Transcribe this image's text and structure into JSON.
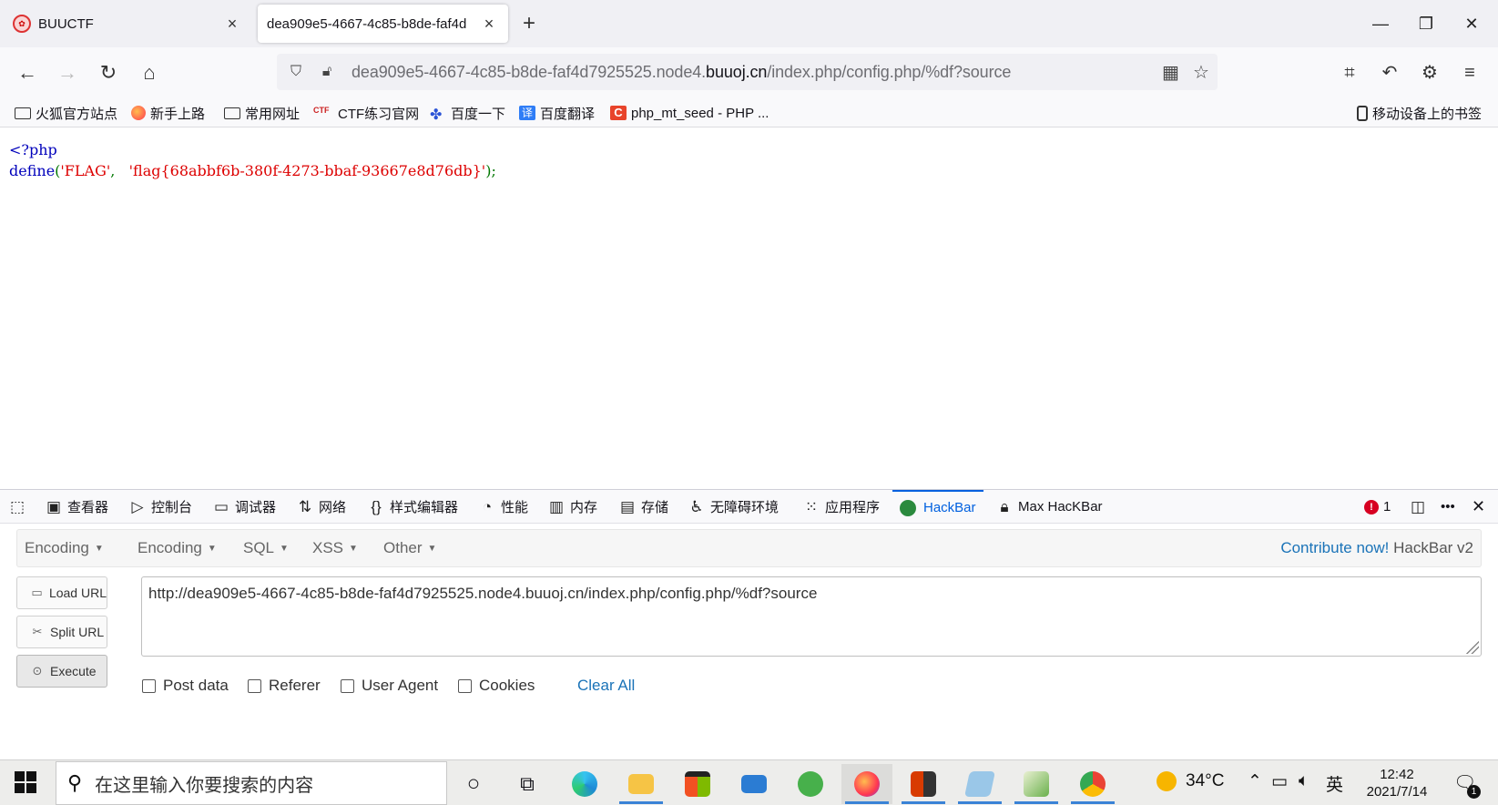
{
  "tabs": [
    {
      "title": "BUUCTF",
      "close": "×"
    },
    {
      "title": "dea909e5-4667-4c85-b8de-faf4d",
      "close": "×"
    }
  ],
  "new_tab": "+",
  "window_controls": {
    "minimize": "—",
    "restore": "❐",
    "close": "✕"
  },
  "nav": {
    "back": "←",
    "forward": "→",
    "reload": "↻",
    "home": "⌂",
    "url_prefix": "dea909e5-4667-4c85-b8de-faf4d7925525.node4.",
    "url_domain": "buuoj.cn",
    "url_path": "/index.php/config.php/%df?source"
  },
  "bookmarks": [
    "火狐官方站点",
    "新手上路",
    "常用网址",
    "CTF练习官网",
    "百度一下",
    "百度翻译",
    "php_mt_seed - PHP ...",
    "移动设备上的书签"
  ],
  "content": {
    "line1": "<?php",
    "define_kw": "define",
    "paren_open": "(",
    "flag_name": "'FLAG'",
    "comma": ",",
    "flag_value": "'flag{68abbf6b-380f-4273-bbaf-93667e8d76db}'",
    "end": ");"
  },
  "devtools": {
    "tabs": [
      "查看器",
      "控制台",
      "调试器",
      "网络",
      "样式编辑器",
      "性能",
      "内存",
      "存储",
      "无障碍环境",
      "应用程序",
      "HackBar",
      "Max HacKBar"
    ],
    "error_count": "1",
    "more": "•••",
    "close": "✕"
  },
  "hackbar": {
    "menu": [
      "Encoding",
      "Encoding",
      "SQL",
      "XSS",
      "Other"
    ],
    "contribute_link": "Contribute now!",
    "version": "HackBar v2",
    "load_url": "Load URL",
    "split_url": "Split URL",
    "execute": "Execute",
    "url_value": "http://dea909e5-4667-4c85-b8de-faf4d7925525.node4.buuoj.cn/index.php/config.php/%df?source",
    "checks": [
      "Post data",
      "Referer",
      "User Agent",
      "Cookies"
    ],
    "clear_all": "Clear All"
  },
  "taskbar": {
    "search_placeholder": "在这里输入你要搜索的内容",
    "weather": "34°C",
    "ime": "英",
    "time": "12:42",
    "date": "2021/7/14",
    "notifications": "1"
  },
  "colors": {
    "accent": "#0060df",
    "php_keyword": "#0000bb",
    "php_string": "#dd0000",
    "php_punct": "#007700",
    "hackbar_link": "#1a73b8"
  }
}
